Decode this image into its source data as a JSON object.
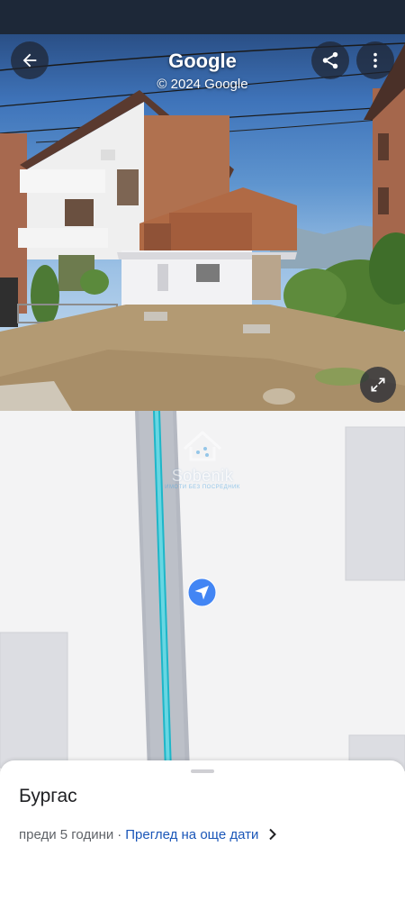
{
  "header": {
    "title": "Google",
    "copyright": "© 2024 Google"
  },
  "icons": {
    "back": "arrow-left",
    "share": "share",
    "more": "more-vertical",
    "expand": "expand-diagonal",
    "location_marker": "navigation-arrow",
    "chevron": "chevron-right"
  },
  "watermark": {
    "brand": "Sobenik",
    "tagline": "ИМОТИ БЕЗ ПОСРЕДНИК"
  },
  "place": {
    "title": "Бургас",
    "age": "преди 5 години",
    "separator": "·",
    "more_dates_link": "Преглед на още дати"
  },
  "colors": {
    "status_bar": "#1d2838",
    "street_line": "#1eb6c8",
    "marker": "#4285f4",
    "link": "#1a56b8"
  }
}
